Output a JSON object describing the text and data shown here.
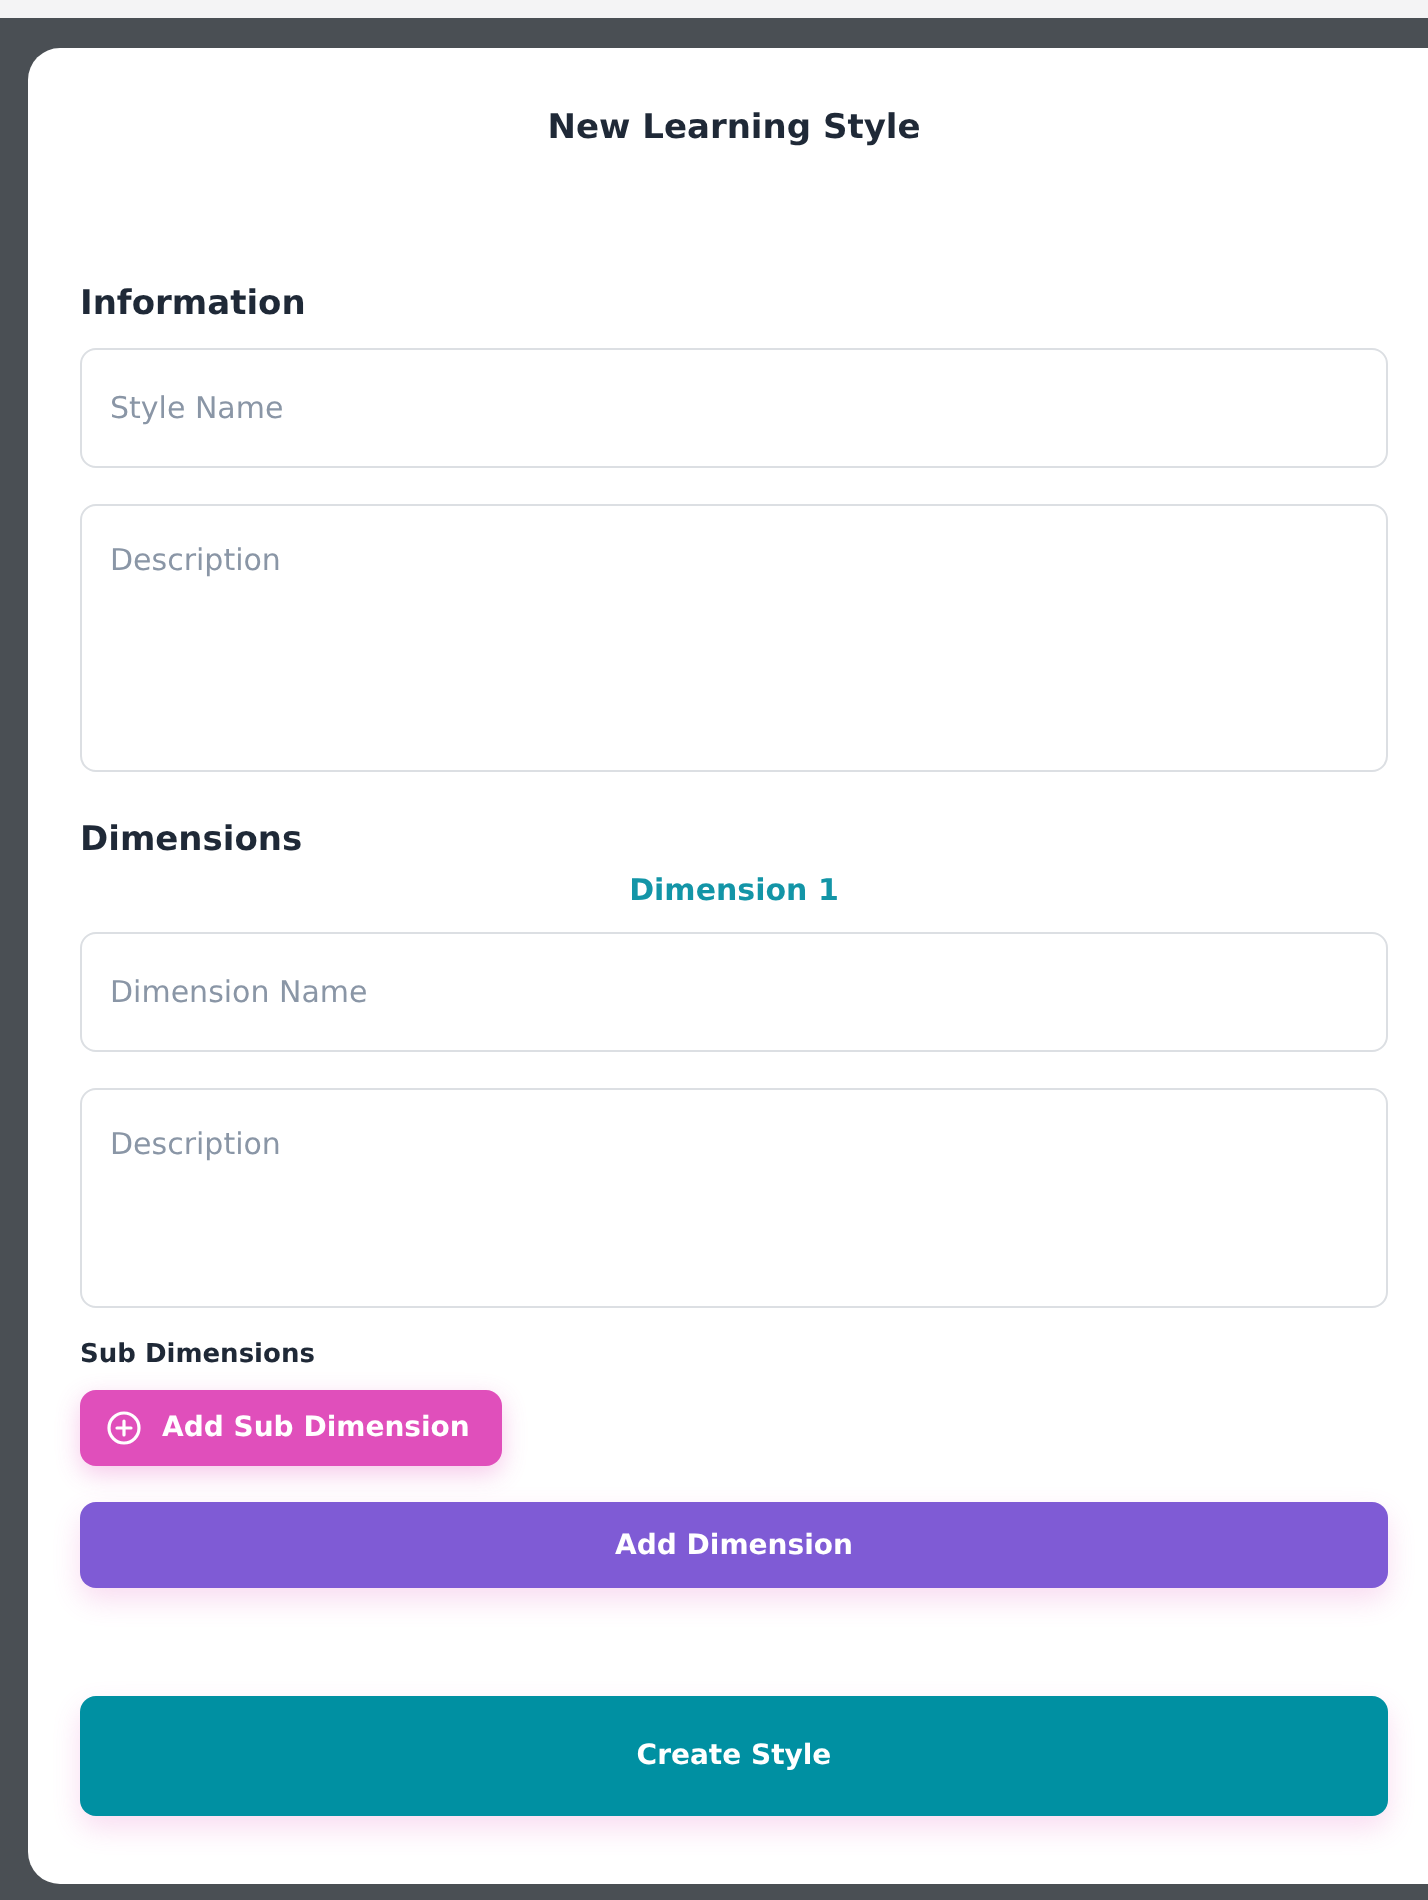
{
  "modal": {
    "title": "New Learning Style"
  },
  "information": {
    "heading": "Information",
    "name_field": {
      "placeholder": "Style Name"
    },
    "description_field": {
      "placeholder": "Description"
    }
  },
  "dimensions": {
    "heading": "Dimensions",
    "items": [
      {
        "title": "Dimension 1",
        "name_field": {
          "placeholder": "Dimension Name"
        },
        "description_field": {
          "placeholder": "Description"
        },
        "sub_dimensions_label": "Sub Dimensions",
        "add_sub_button": "Add Sub Dimension"
      }
    ],
    "add_button": "Add Dimension"
  },
  "submit_button": "Create Style"
}
